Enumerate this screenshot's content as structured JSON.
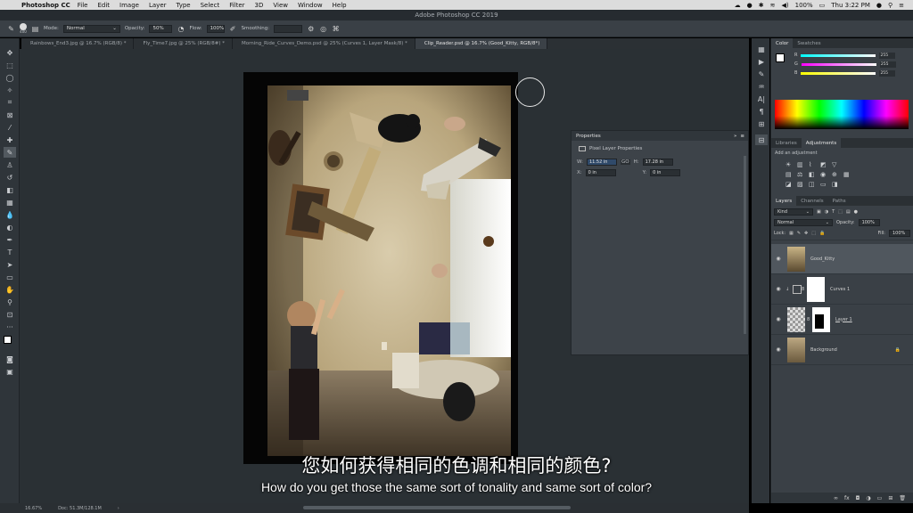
{
  "menubar": {
    "app": "Photoshop CC",
    "items": [
      "File",
      "Edit",
      "Image",
      "Layer",
      "Type",
      "Select",
      "Filter",
      "3D",
      "View",
      "Window",
      "Help"
    ],
    "battery": "100%",
    "clock": "Thu 3:22 PM"
  },
  "window": {
    "title": "Adobe Photoshop CC 2019"
  },
  "options": {
    "brush_size": "400",
    "mode_label": "Mode:",
    "mode_value": "Normal",
    "opacity_label": "Opacity:",
    "opacity_value": "50%",
    "flow_label": "Flow:",
    "flow_value": "100%",
    "smoothing_label": "Smoothing:"
  },
  "tabs": [
    {
      "label": "Rainbows_End3.jpg @ 16.7% (RGB/8) *"
    },
    {
      "label": "Fly_Time7.jpg @ 25% (RGB/8#) *"
    },
    {
      "label": "Morning_Ride_Curves_Demo.psd @ 25% (Curves 1, Layer Mask/8) *"
    },
    {
      "label": "Clip_Reader.psd @ 16.7% (Good_Kitty, RGB/8*)"
    }
  ],
  "properties": {
    "title": "Properties",
    "subtitle": "Pixel Layer Properties",
    "w_label": "W:",
    "w_value": "11.52 in",
    "link": "GO",
    "h_label": "H:",
    "h_value": "17.28 in",
    "x_label": "X:",
    "x_value": "0 in",
    "y_label": "Y:",
    "y_value": "0 in"
  },
  "color_panel": {
    "tabs": [
      "Color",
      "Swatches"
    ],
    "r_label": "R",
    "r_value": "255",
    "g_label": "G",
    "g_value": "255",
    "b_label": "B",
    "b_value": "255"
  },
  "adjust_panel": {
    "tabs": [
      "Libraries",
      "Adjustments"
    ],
    "add_label": "Add an adjustment"
  },
  "layers_panel": {
    "tabs": [
      "Layers",
      "Channels",
      "Paths"
    ],
    "filter_kind": "Kind",
    "blend_mode": "Normal",
    "opacity_label": "Opacity:",
    "opacity_value": "100%",
    "lock_label": "Lock:",
    "fill_label": "Fill:",
    "fill_value": "100%",
    "layers": [
      {
        "name": "Good_Kitty"
      },
      {
        "name": "Curves 1"
      },
      {
        "name": "Layer 1"
      },
      {
        "name": "Background"
      }
    ]
  },
  "statusbar": {
    "zoom": "16.67%",
    "doc": "Doc: 51.3M/128.1M"
  },
  "subtitles": {
    "chinese": "您如何获得相同的色调和相同的颜色?",
    "english": "How do you get those the same sort of tonality and same sort of color?"
  },
  "colors": {
    "panel_bg": "#3a4046",
    "canvas_bg": "#2a3034",
    "selection": "#50575e"
  }
}
